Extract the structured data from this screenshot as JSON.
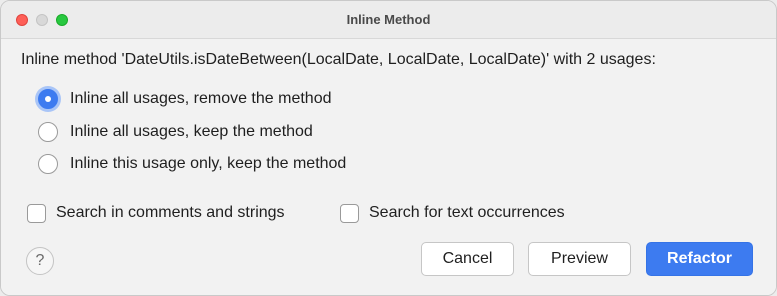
{
  "window": {
    "title": "Inline Method"
  },
  "dialog": {
    "description": "Inline method 'DateUtils.isDateBetween(LocalDate, LocalDate, LocalDate)' with 2 usages:",
    "options": [
      {
        "label": "Inline all usages, remove the method",
        "selected": true
      },
      {
        "label": "Inline all usages, keep the method",
        "selected": false
      },
      {
        "label": "Inline this usage only, keep the method",
        "selected": false
      }
    ],
    "checkboxes": [
      {
        "label": "Search in comments and strings",
        "checked": false
      },
      {
        "label": "Search for text occurrences",
        "checked": false
      }
    ]
  },
  "footer": {
    "help_label": "?",
    "cancel_label": "Cancel",
    "preview_label": "Preview",
    "refactor_label": "Refactor"
  },
  "colors": {
    "accent": "#3d7bf0",
    "close": "#fe5f57",
    "maximize": "#28c840"
  }
}
